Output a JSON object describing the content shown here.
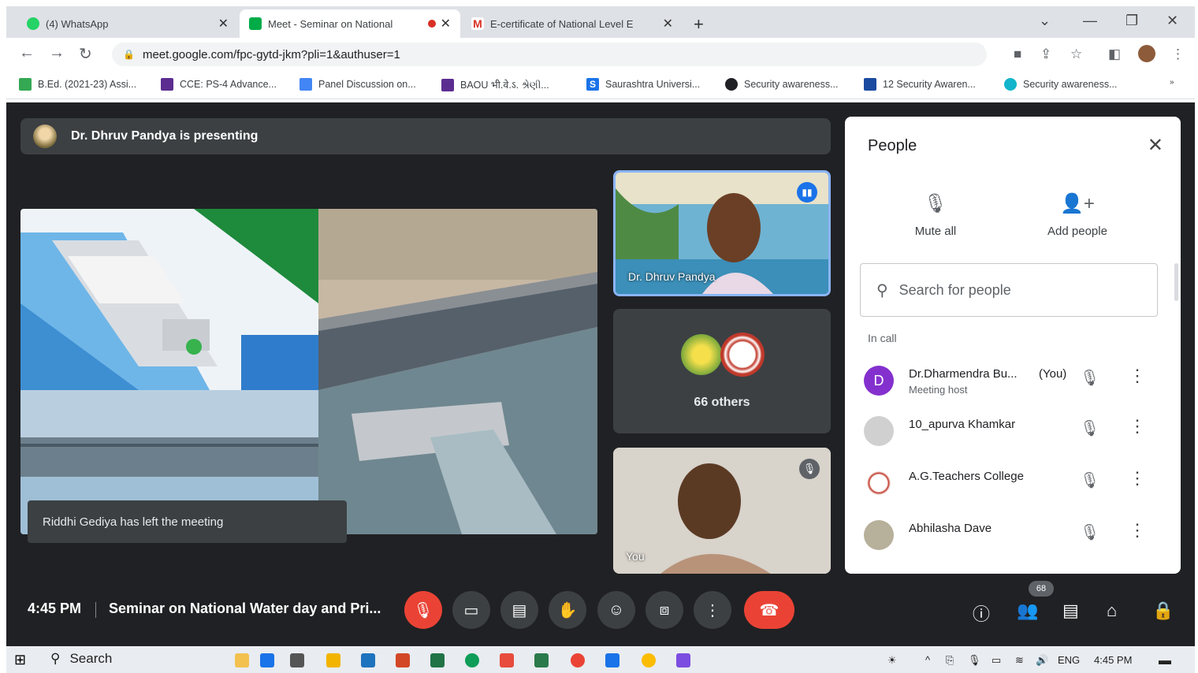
{
  "browser": {
    "tabs": [
      {
        "title": "(4) WhatsApp",
        "color": "#25d366"
      },
      {
        "title": "Meet - Seminar on National",
        "color": "#00ac47"
      },
      {
        "title": "E-certificate of National Level E",
        "color": "#d93025"
      }
    ],
    "url": "meet.google.com/fpc-gytd-jkm?pli=1&authuser=1",
    "bookmarks": [
      {
        "label": "B.Ed. (2021-23) Assi...",
        "color": "#34a853"
      },
      {
        "label": "CCE: PS-4 Advance...",
        "color": "#5c2d91"
      },
      {
        "label": "Panel Discussion on...",
        "color": "#4285f4"
      },
      {
        "label": "BAOU भी.वे.ऽ. શ્રેણી...",
        "color": "#5c2d91"
      },
      {
        "label": "Saurashtra Universi...",
        "color": "#1a73e8"
      },
      {
        "label": "Security awareness...",
        "color": "#202124"
      },
      {
        "label": "12 Security Awaren...",
        "color": "#1a4aa0"
      },
      {
        "label": "Security awareness...",
        "color": "#12b5cb"
      }
    ]
  },
  "meet": {
    "presenting_text": "Dr. Dhruv Pandya is presenting",
    "notification": "Riddhi Gediya has left the meeting",
    "tiles": {
      "speaker_name": "Dr. Dhruv Pandya",
      "others_label": "66 others",
      "self_name": "You"
    },
    "time": "4:45 PM",
    "meeting_title": "Seminar on National Water day and Pri...",
    "people_count_badge": "68"
  },
  "people_panel": {
    "title": "People",
    "mute_all": "Mute all",
    "add_people": "Add people",
    "search_placeholder": "Search for people",
    "section": "In call",
    "participants": [
      {
        "name": "Dr.Dharmendra Bu...",
        "role": "Meeting host",
        "you": "(You)",
        "initial": "D",
        "color": "#8430ce"
      },
      {
        "name": "10_apurva Khamkar",
        "role": "",
        "you": "",
        "initial": "",
        "color": "#c8c8c8"
      },
      {
        "name": "A.G.Teachers College",
        "role": "",
        "you": "",
        "initial": "",
        "color": "#e8b4b4"
      },
      {
        "name": "Abhilasha Dave",
        "role": "",
        "you": "",
        "initial": "",
        "color": "#b7b09a"
      }
    ]
  },
  "taskbar": {
    "search_label": "Search",
    "language": "ENG",
    "time": "4:45 PM"
  }
}
